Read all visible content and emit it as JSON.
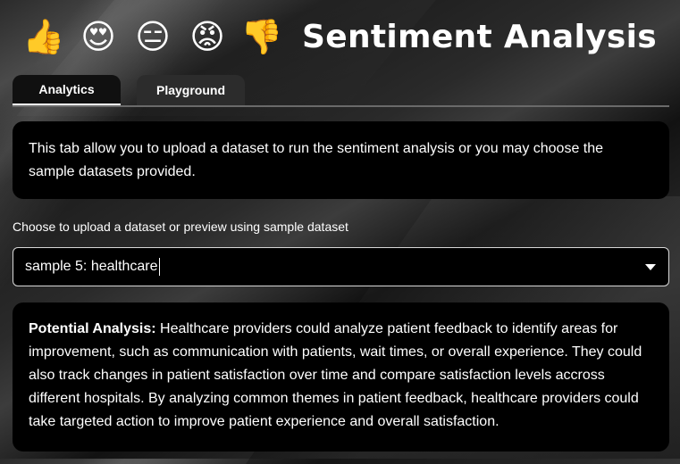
{
  "header": {
    "emojis": [
      "👍",
      "😍",
      "😑",
      "😡",
      "👎"
    ],
    "emoji_names": [
      "thumbs-up-icon",
      "heart-eyes-icon",
      "expressionless-face-icon",
      "angry-face-icon",
      "thumbs-down-icon"
    ],
    "title": "Sentiment Analysis"
  },
  "tabs": [
    {
      "label": "Analytics",
      "active": true
    },
    {
      "label": "Playground",
      "active": false
    }
  ],
  "info": {
    "text": "This tab allow you to upload a dataset to run the sentiment analysis or you may choose the sample datasets provided."
  },
  "dataset_select": {
    "label": "Choose to upload a dataset or preview using sample dataset",
    "value": "sample 5: healthcare"
  },
  "analysis": {
    "heading": "Potential Analysis:",
    "text": " Healthcare providers could analyze patient feedback to identify areas for improvement, such as communication with patients, wait times, or overall experience. They could also track changes in patient satisfaction over time and compare satisfaction levels accross different hospitals. By analyzing common themes in patient feedback, healthcare providers could take targeted action to improve patient experience and overall satisfaction."
  },
  "colors": {
    "card_bg": "#000000",
    "text": "#ffffff",
    "tab_active_underline": "#ffffff",
    "tab_inactive_bg": "#2c2c2c"
  }
}
